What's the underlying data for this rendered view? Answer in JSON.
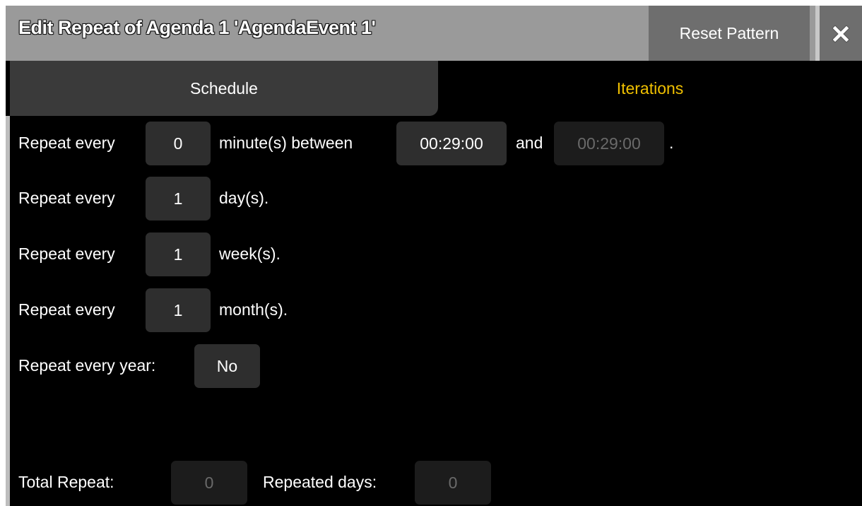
{
  "window": {
    "title": "Edit Repeat of Agenda 1 'AgendaEvent 1'",
    "reset_label": "Reset Pattern",
    "close_icon": "close-icon"
  },
  "tabs": [
    {
      "label": "Schedule",
      "active": true
    },
    {
      "label": "Iterations",
      "active": false,
      "color": "#f0c000"
    }
  ],
  "schedule": {
    "minutes": {
      "label": "Repeat every",
      "value": "0",
      "suffix": "minute(s) between",
      "start": "00:29:00",
      "and": "and",
      "end": "00:29:00",
      "end_suffix": "."
    },
    "days": {
      "label": "Repeat every",
      "value": "1",
      "suffix": "day(s)."
    },
    "weeks": {
      "label": "Repeat every",
      "value": "1",
      "suffix": "week(s)."
    },
    "months": {
      "label": "Repeat every",
      "value": "1",
      "suffix": "month(s)."
    },
    "year": {
      "label": "Repeat every year:",
      "value": "No"
    }
  },
  "totals": {
    "total_label": "Total Repeat:",
    "total_value": "0",
    "days_label": "Repeated days:",
    "days_value": "0"
  }
}
